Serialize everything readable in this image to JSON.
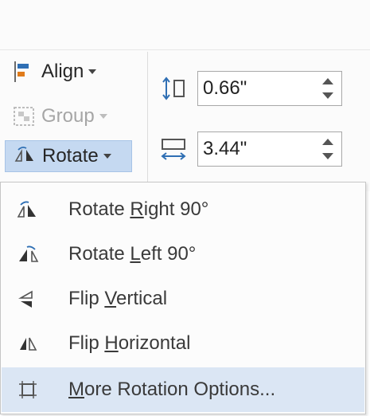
{
  "ribbon": {
    "align": {
      "label": "Align",
      "icon": "align-icon"
    },
    "group": {
      "label": "Group",
      "icon": "group-icon",
      "disabled": true
    },
    "rotate": {
      "label": "Rotate",
      "icon": "rotate-icon",
      "active": true
    },
    "height_value": "0.66\"",
    "width_value": "3.44\""
  },
  "menu": {
    "items": [
      {
        "pre": "Rotate ",
        "key": "R",
        "post": "ight 90°",
        "icon": "rotate-right-icon"
      },
      {
        "pre": "Rotate ",
        "key": "L",
        "post": "eft 90°",
        "icon": "rotate-left-icon"
      },
      {
        "pre": "Flip ",
        "key": "V",
        "post": "ertical",
        "icon": "flip-vertical-icon"
      },
      {
        "pre": "Flip ",
        "key": "H",
        "post": "orizontal",
        "icon": "flip-horizontal-icon"
      },
      {
        "pre": "",
        "key": "M",
        "post": "ore Rotation Options...",
        "icon": "more-rotation-options-icon",
        "highlighted": true
      }
    ]
  },
  "colors": {
    "highlight": "#dbe6f4",
    "active_button": "#c5d9f1",
    "icon_blue": "#2f6fb4",
    "icon_orange": "#e07b1a"
  }
}
